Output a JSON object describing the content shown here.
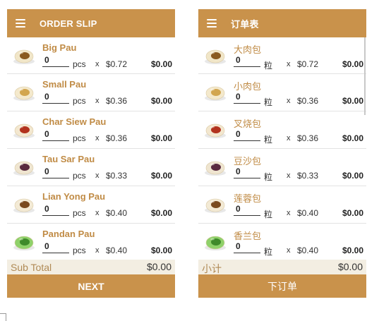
{
  "left": {
    "title": "ORDER SLIP",
    "items": [
      {
        "name": "Big Pau",
        "qty": "0",
        "unit": "pcs",
        "times": "x",
        "price": "$0.72",
        "total": "$0.00",
        "icon": "big-pau-icon"
      },
      {
        "name": "Small Pau",
        "qty": "0",
        "unit": "pcs",
        "times": "x",
        "price": "$0.36",
        "total": "$0.00",
        "icon": "small-pau-icon"
      },
      {
        "name": "Char Siew Pau",
        "qty": "0",
        "unit": "pcs",
        "times": "x",
        "price": "$0.36",
        "total": "$0.00",
        "icon": "char-siew-pau-icon"
      },
      {
        "name": "Tau Sar Pau",
        "qty": "0",
        "unit": "pcs",
        "times": "x",
        "price": "$0.33",
        "total": "$0.00",
        "icon": "tau-sar-pau-icon"
      },
      {
        "name": "Lian Yong Pau",
        "qty": "0",
        "unit": "pcs",
        "times": "x",
        "price": "$0.40",
        "total": "$0.00",
        "icon": "lian-yong-pau-icon"
      },
      {
        "name": "Pandan Pau",
        "qty": "0",
        "unit": "pcs",
        "times": "x",
        "price": "$0.40",
        "total": "$0.00",
        "icon": "pandan-pau-icon"
      }
    ],
    "subtotal_label": "Sub Total",
    "subtotal_value": "$0.00",
    "button": "NEXT"
  },
  "right": {
    "title": "订单表",
    "items": [
      {
        "name": "大肉包",
        "qty": "0",
        "unit": "粒",
        "times": "x",
        "price": "$0.72",
        "total": "$0.00",
        "icon": "big-pau-icon"
      },
      {
        "name": "小肉包",
        "qty": "0",
        "unit": "粒",
        "times": "x",
        "price": "$0.36",
        "total": "$0.00",
        "icon": "small-pau-icon"
      },
      {
        "name": "叉烧包",
        "qty": "0",
        "unit": "粒",
        "times": "x",
        "price": "$0.36",
        "total": "$0.00",
        "icon": "char-siew-pau-icon"
      },
      {
        "name": "豆沙包",
        "qty": "0",
        "unit": "粒",
        "times": "x",
        "price": "$0.33",
        "total": "$0.00",
        "icon": "tau-sar-pau-icon"
      },
      {
        "name": "莲蓉包",
        "qty": "0",
        "unit": "粒",
        "times": "x",
        "price": "$0.40",
        "total": "$0.00",
        "icon": "lian-yong-pau-icon"
      },
      {
        "name": "香兰包",
        "qty": "0",
        "unit": "粒",
        "times": "x",
        "price": "$0.40",
        "total": "$0.00",
        "icon": "pandan-pau-icon"
      }
    ],
    "subtotal_label": "小计",
    "subtotal_value": "$0.00",
    "button": "下订单"
  },
  "colors": {
    "accent": "#c9924b",
    "item_name": "#c08b45",
    "subtotal_bg": "#f3eee2"
  }
}
